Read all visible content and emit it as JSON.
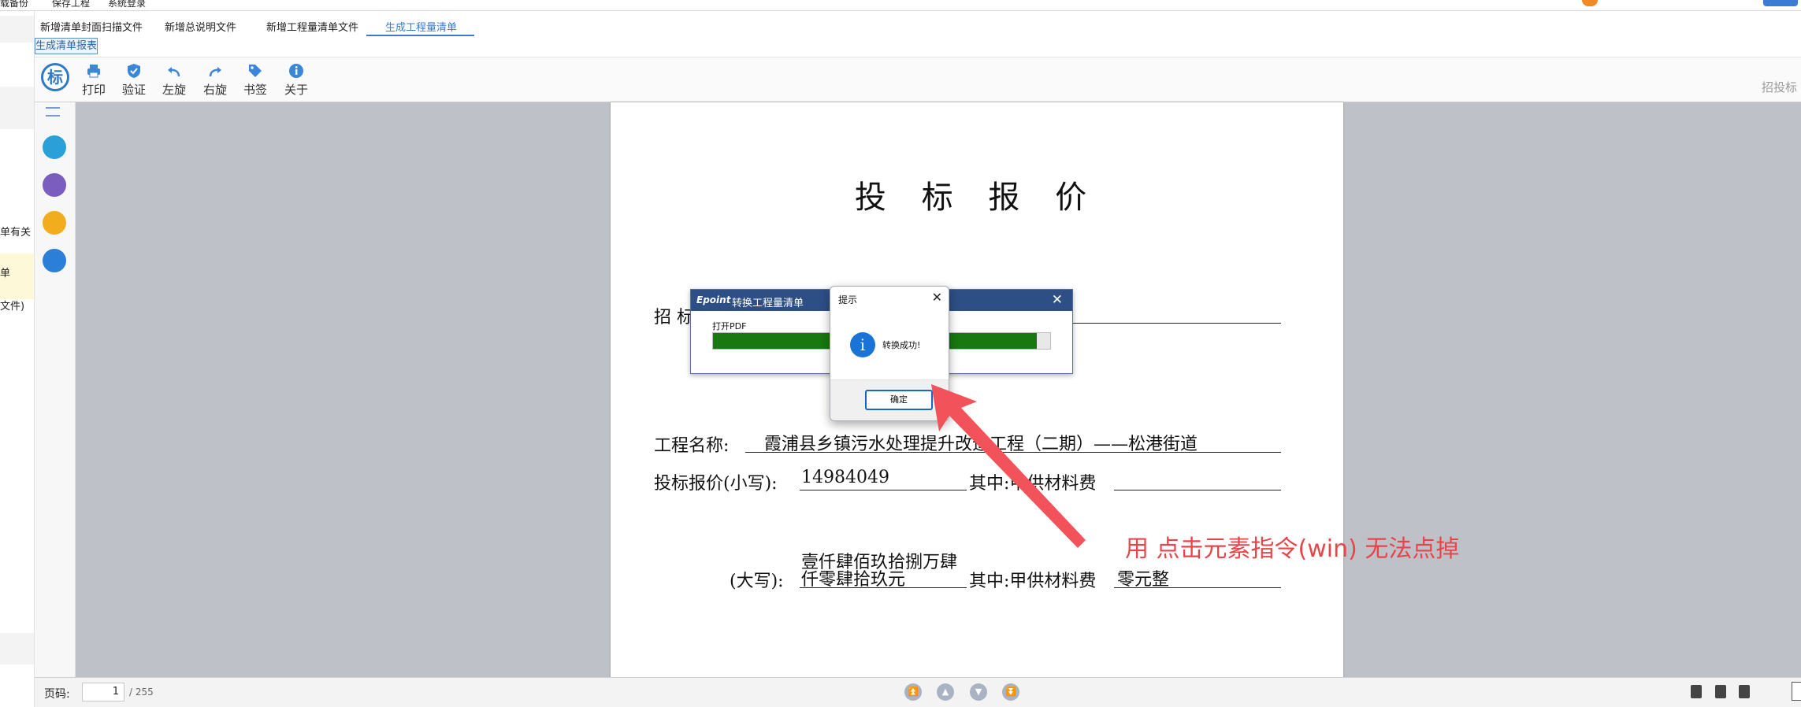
{
  "menu": {
    "items": [
      "载备份",
      "保存工程",
      "系统登录"
    ]
  },
  "left_panel": {
    "texts": [
      "单有关",
      "单",
      "文件)"
    ]
  },
  "tabs": [
    {
      "label": "新增清单封面扫描文件",
      "active": false
    },
    {
      "label": "新增总说明文件",
      "active": false
    },
    {
      "label": "新增工程量清单文件",
      "active": false
    },
    {
      "label": "生成工程量清单",
      "active": true
    }
  ],
  "subtab": {
    "label": "生成清单报表"
  },
  "toolbar": {
    "logo_text": "标",
    "print": "打印",
    "verify": "验证",
    "rotate_left": "左旋",
    "rotate_right": "右旋",
    "bookmark": "书签",
    "about": "关于",
    "right_label": "招投标"
  },
  "document": {
    "title": "投 标 报 价",
    "line_partial": "招 标",
    "project_label": "工程名称:",
    "project_value": "霞浦县乡镇污水处理提升改造工程（二期）——松港街道",
    "bid_label": "投标报价(小写):",
    "bid_value": "14984049",
    "materials_label": "其中:甲供材料费",
    "capital_label": "(大写):",
    "capital_value_1": "壹仟肆佰玖拾捌万肆",
    "capital_value_2": "仟零肆拾玖元",
    "materials_label_2": "其中:甲供材料费",
    "materials_value_2": "零元整"
  },
  "convert_dialog": {
    "brand": "Epoint",
    "title": "转换工程量清单",
    "close": "✕",
    "step_label": "打开PDF",
    "progress": 0.96
  },
  "message_box": {
    "title": "提示",
    "close": "✕",
    "info_glyph": "i",
    "message": "转换成功!",
    "ok_label": "确定"
  },
  "annotation": {
    "text": "用 点击元素指令(win) 无法点掉",
    "color": "#e8454b"
  },
  "bottom_bar": {
    "page_label": "页码:",
    "current_page": "1",
    "total_pages": "/ 255"
  },
  "colors": {
    "accent": "#3a7ad1",
    "progress": "#17790f",
    "dialog_header": "#2d4f86"
  }
}
